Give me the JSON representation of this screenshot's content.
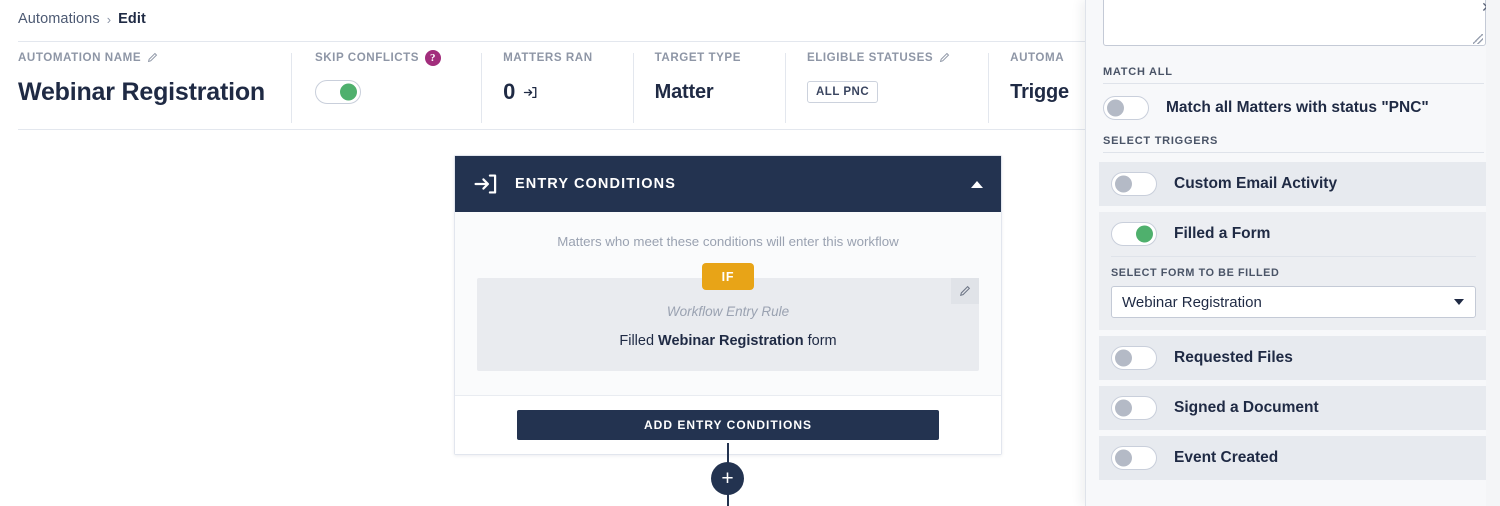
{
  "breadcrumb": {
    "parent": "Automations",
    "separator": "›",
    "current": "Edit"
  },
  "stats": [
    {
      "label": "AUTOMATION NAME",
      "icon": "pencil-icon",
      "value": "Webinar Registration",
      "type": "text"
    },
    {
      "label": "SKIP CONFLICTS",
      "icon": "help-icon",
      "value": "",
      "type": "toggle",
      "toggle_on": true
    },
    {
      "label": "MATTERS RAN",
      "icon": "",
      "value": "0",
      "type": "value-with-icon",
      "value_icon": "enter-icon"
    },
    {
      "label": "TARGET TYPE",
      "icon": "",
      "value": "Matter",
      "type": "text"
    },
    {
      "label": "ELIGIBLE STATUSES",
      "icon": "pencil-icon",
      "value": "ALL PNC",
      "type": "chip"
    },
    {
      "label": "AUTOMA",
      "icon": "",
      "value": "Trigge",
      "type": "text"
    }
  ],
  "card": {
    "icon": "enter-icon",
    "title": "ENTRY CONDITIONS",
    "collapse_icon": "caret-up-icon",
    "note": "Matters who meet these conditions will enter this workflow",
    "if_label": "IF",
    "rule": {
      "edit_icon": "pencil-icon",
      "kind": "Workflow Entry Rule",
      "text_prefix": "Filled ",
      "text_bold": "Webinar Registration",
      "text_suffix": " form"
    },
    "add_button": "ADD ENTRY CONDITIONS",
    "plus_node": "+"
  },
  "panel": {
    "close_label": "✕",
    "textarea_value": "",
    "textarea_placeholder": "",
    "match_all": {
      "section_label": "MATCH ALL",
      "toggle_on": false,
      "label": "Match all Matters with status \"PNC\""
    },
    "select_triggers": {
      "section_label": "SELECT TRIGGERS",
      "items": [
        {
          "label": "Custom Email Activity",
          "toggle_on": false
        },
        {
          "label": "Filled a Form",
          "toggle_on": true
        },
        {
          "label": "Requested Files",
          "toggle_on": false
        },
        {
          "label": "Signed a Document",
          "toggle_on": false
        },
        {
          "label": "Event Created",
          "toggle_on": false
        }
      ]
    },
    "form_select": {
      "label": "SELECT FORM TO BE FILLED",
      "value": "Webinar Registration",
      "caret_icon": "chevron-down-icon"
    }
  },
  "colors": {
    "navy": "#233350",
    "amber": "#e8a417",
    "green": "#4fb06d",
    "magenta": "#a22d7c",
    "panel_bg": "#f7f8fa"
  }
}
